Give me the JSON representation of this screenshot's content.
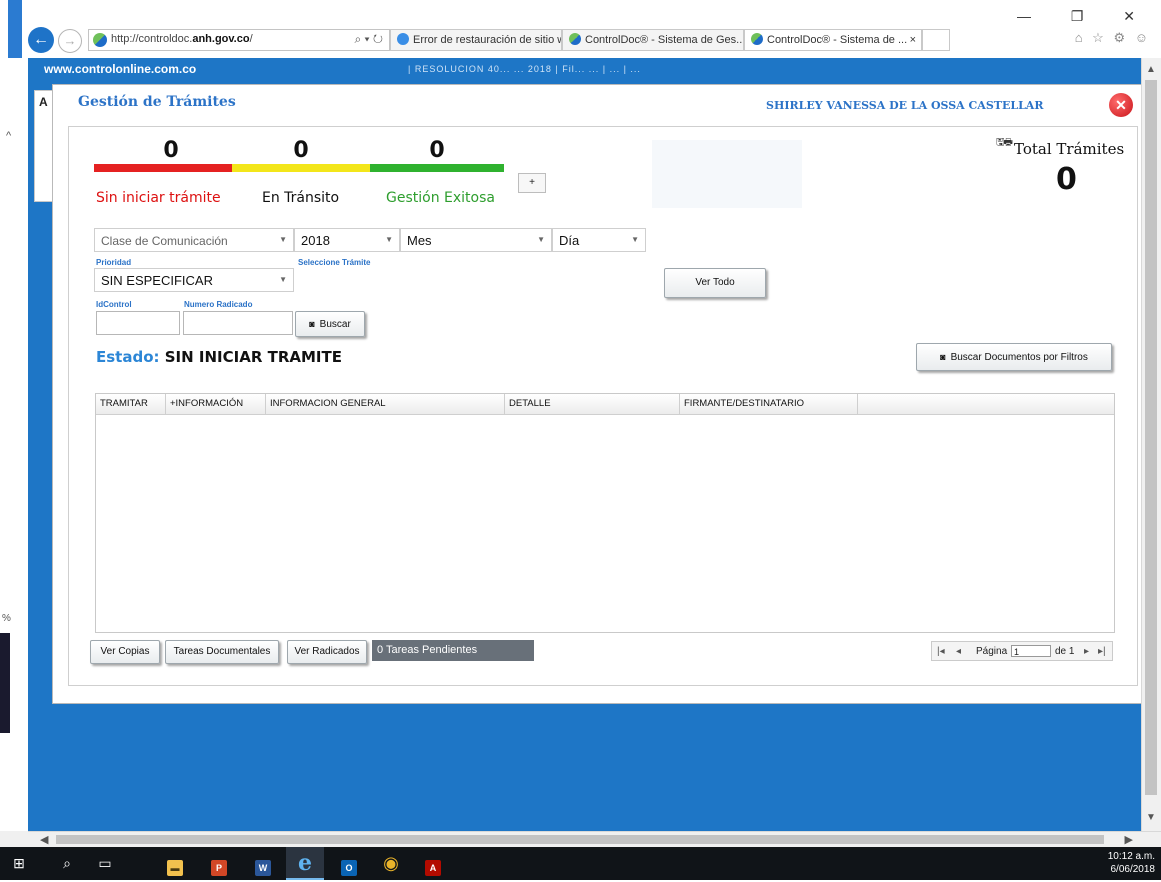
{
  "browser": {
    "url_prefix": "http://controldoc.",
    "url_domain": "anh.gov.co",
    "url_suffix": "/",
    "address_controls": "⌕ ▾ ↻",
    "tabs": [
      {
        "title": "Error de restauración de sitio w..."
      },
      {
        "title": "ControlDoc® - Sistema de Ges..."
      },
      {
        "title": "ControlDoc® - Sistema de ...",
        "close": "×"
      }
    ],
    "window_controls": "—  ❐  ✕",
    "toolbar_icons": "⌂ ☆ ⚙ ☺"
  },
  "site": {
    "name": "www.controlonline.com.co",
    "ticker": "  |  RESOLUCION  40...  ...  2018  |  Fil...  ...  |  ...  |  ...",
    "bg_panel_letter": "A",
    "left_gutter_1": "^",
    "left_gutter_2": "%"
  },
  "modal": {
    "title": "Gestión de Trámites",
    "user": "SHIRLEY VANESSA DE LA OSSA CASTELLAR",
    "close": "✕"
  },
  "counters": {
    "sin_iniciar": {
      "value": "0",
      "label": "Sin iniciar trámite",
      "color": "#e52121"
    },
    "en_transito": {
      "value": "0",
      "label": "En Tránsito",
      "color": "#f3e61a"
    },
    "exitosa": {
      "value": "0",
      "label": "Gestión Exitosa",
      "color": "#2fb22f"
    },
    "plus": "+"
  },
  "total": {
    "title": "Total Trámites",
    "value": "0",
    "icons": "🖫🖶"
  },
  "filters": {
    "clase": "Clase de Comunicación",
    "year": "2018",
    "mes": "Mes",
    "dia": "Día",
    "prioridad_label": "Prioridad",
    "seleccione_tramite_label": "Seleccione Trámite",
    "prioridad_value": "SIN ESPECIFICAR",
    "idcontrol_label": "IdControl",
    "numero_radicado_label": "Numero Radicado",
    "idcontrol_value": "",
    "numero_radicado_value": "",
    "buscar": "Buscar",
    "ver_todo": "Ver Todo",
    "buscar_filtros": "Buscar Documentos por Filtros"
  },
  "estado": {
    "key": "Estado:",
    "value": "SIN INICIAR TRAMITE"
  },
  "grid": {
    "columns": [
      "TRAMITAR",
      "+INFORMACIÓN",
      "INFORMACION GENERAL",
      "DETALLE",
      "FIRMANTE/DESTINATARIO",
      ""
    ]
  },
  "bottom": {
    "ver_copias": "Ver Copias",
    "tareas_documentales": "Tareas Documentales",
    "ver_radicados": "Ver Radicados",
    "pendientes": "0 Tareas Pendientes",
    "pager_first": "|◂",
    "pager_prev": "◂",
    "pager_label": "Página",
    "pager_page": "1",
    "pager_of": "de 1",
    "pager_next": "▸",
    "pager_last": "▸|"
  },
  "scroll": {
    "up": "▲",
    "down": "▼",
    "left": "◀",
    "right": "▶"
  },
  "taskbar": {
    "start": "⊞",
    "search": "⌕",
    "taskview": "▭",
    "explorer": "▬",
    "ppt": "P",
    "word": "W",
    "ie": "e",
    "outlook": "O",
    "chrome": "◉",
    "acrobat": "A",
    "time": "10:12 a.m.",
    "date": "6/06/2018"
  }
}
